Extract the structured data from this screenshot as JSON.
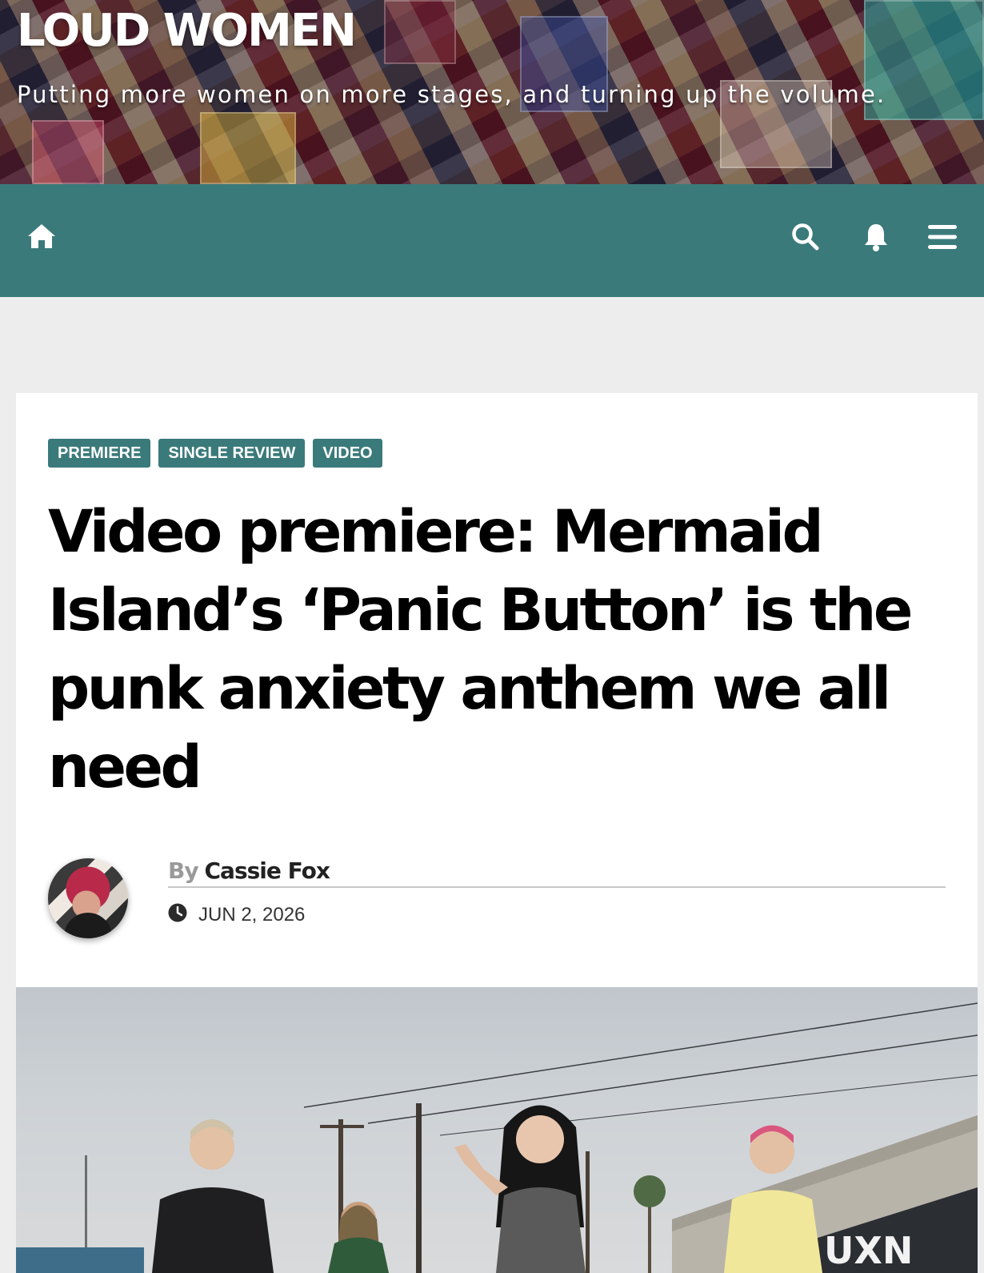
{
  "site": {
    "title": "LOUD WOMEN",
    "tagline": "Putting more women on more stages, and turning up the volume."
  },
  "nav": {
    "icons": [
      "home-icon",
      "search-icon",
      "bell-icon",
      "menu-icon"
    ],
    "background": "#3b7a7b"
  },
  "article": {
    "categories": [
      "PREMIERE",
      "SINGLE REVIEW",
      "VIDEO"
    ],
    "title": "Video premiere: Mermaid Island’s ‘Panic Button’ is the punk anxiety anthem we all need",
    "by_label": "By",
    "author": "Cassie Fox",
    "date": "JUN 2, 2026"
  },
  "colors": {
    "accent": "#3b7a7b",
    "page_background": "#ededed",
    "card_background": "#ffffff"
  }
}
